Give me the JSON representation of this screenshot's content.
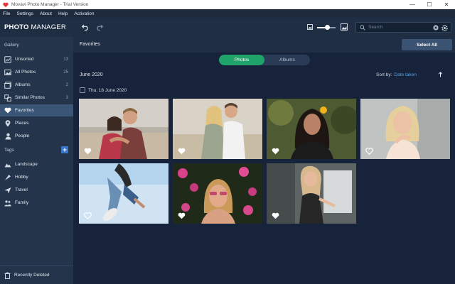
{
  "window": {
    "title": "Movavi Photo Manager - Trial Version",
    "minimize": "—",
    "maximize": "☐",
    "close": "✕"
  },
  "menu": [
    "File",
    "Settings",
    "About",
    "Help",
    "Activation"
  ],
  "toolbar": {
    "brand_bold": "PHOTO",
    "brand_rest": " MANAGER",
    "search_placeholder": "Search",
    "zoom_level": 0.55
  },
  "sidebar": {
    "gallery_label": "Gallery",
    "items": [
      {
        "label": "Unsorted",
        "count": "13",
        "icon": "unsorted-icon"
      },
      {
        "label": "All Photos",
        "count": "25",
        "icon": "photos-icon"
      },
      {
        "label": "Albums",
        "count": "2",
        "icon": "albums-icon"
      },
      {
        "label": "Similar Photos",
        "count": "3",
        "icon": "similar-icon"
      },
      {
        "label": "Favorites",
        "count": "",
        "icon": "heart-icon"
      },
      {
        "label": "Places",
        "count": "",
        "icon": "pin-icon"
      },
      {
        "label": "People",
        "count": "",
        "icon": "person-icon"
      }
    ],
    "tags_label": "Tags",
    "tags": [
      {
        "label": "Landscape",
        "icon": "landscape-icon"
      },
      {
        "label": "Hobby",
        "icon": "hobby-icon"
      },
      {
        "label": "Travel",
        "icon": "travel-icon"
      },
      {
        "label": "Family",
        "icon": "family-icon"
      }
    ],
    "recently_deleted": "Recently Deleted"
  },
  "main": {
    "title": "Favorites",
    "select_all": "Select All",
    "tabs": [
      {
        "label": "Photos",
        "active": true
      },
      {
        "label": "Albums",
        "active": false
      }
    ],
    "month": "June 2020",
    "sort_label": "Sort by:",
    "sort_value": "Date taken",
    "day_label": "Thu, 18 June 2020"
  },
  "colors": {
    "accent_green": "#1fa36a",
    "link_blue": "#4ea3e8",
    "active_item": "#3a5576"
  }
}
